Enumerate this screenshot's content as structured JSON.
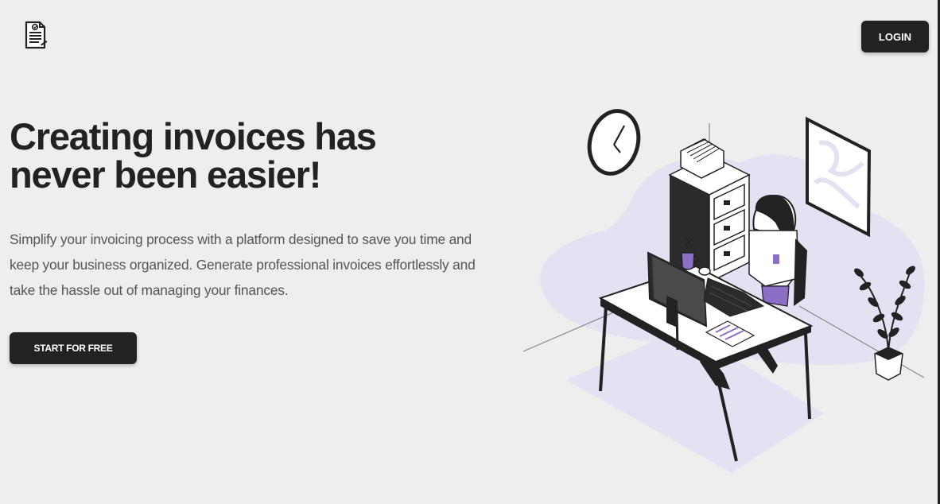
{
  "header": {
    "logo_icon": "invoice-document-icon",
    "login_label": "LOGIN"
  },
  "hero": {
    "title_line1": "Creating invoices has",
    "title_line2": "never been easier!",
    "description_line1": "Simplify your invoicing process with a platform designed to save you time and",
    "description_line2": "keep your business organized. Generate professional invoices effortlessly and",
    "description_line3": "take the hassle out of managing your finances.",
    "cta_label": "START FOR FREE"
  },
  "illustration": {
    "subject": "woman-working-at-desk-illustration"
  },
  "colors": {
    "background": "#eeeeee",
    "button": "#222222",
    "accent_purple": "#8b6fc6",
    "lavender": "#e6e0f3"
  }
}
